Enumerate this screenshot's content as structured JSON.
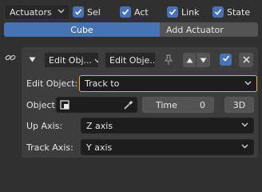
{
  "top": {
    "mode_dropdown": "Actuators",
    "checkboxes": [
      {
        "label": "Sel",
        "checked": true
      },
      {
        "label": "Act",
        "checked": true
      },
      {
        "label": "Link",
        "checked": true
      },
      {
        "label": "State",
        "checked": true
      }
    ]
  },
  "tabs": {
    "active": "Cube",
    "add": "Add Actuator"
  },
  "actuator": {
    "type_dropdown": "Edit Obj...",
    "name_field": "Edit Obje...",
    "edit_object_label": "Edit Object:",
    "edit_object_value": "Track to",
    "object_label": "Object:",
    "time_label": "Time",
    "time_value": "0",
    "three_d_label": "3D",
    "up_axis_label": "Up Axis:",
    "up_axis_value": "Z axis",
    "track_axis_label": "Track Axis:",
    "track_axis_value": "Y axis"
  },
  "colors": {
    "accent": "#4772b3",
    "highlight": "#f2b01e",
    "background": "#303030",
    "panel": "#3d3d3d"
  },
  "icons": [
    "chevron-down-icon",
    "checkmark-icon",
    "link-icon",
    "triangle-down-icon",
    "pin-icon",
    "arrow-up-icon",
    "arrow-down-icon",
    "close-icon",
    "object-icon",
    "eyedropper-icon"
  ]
}
